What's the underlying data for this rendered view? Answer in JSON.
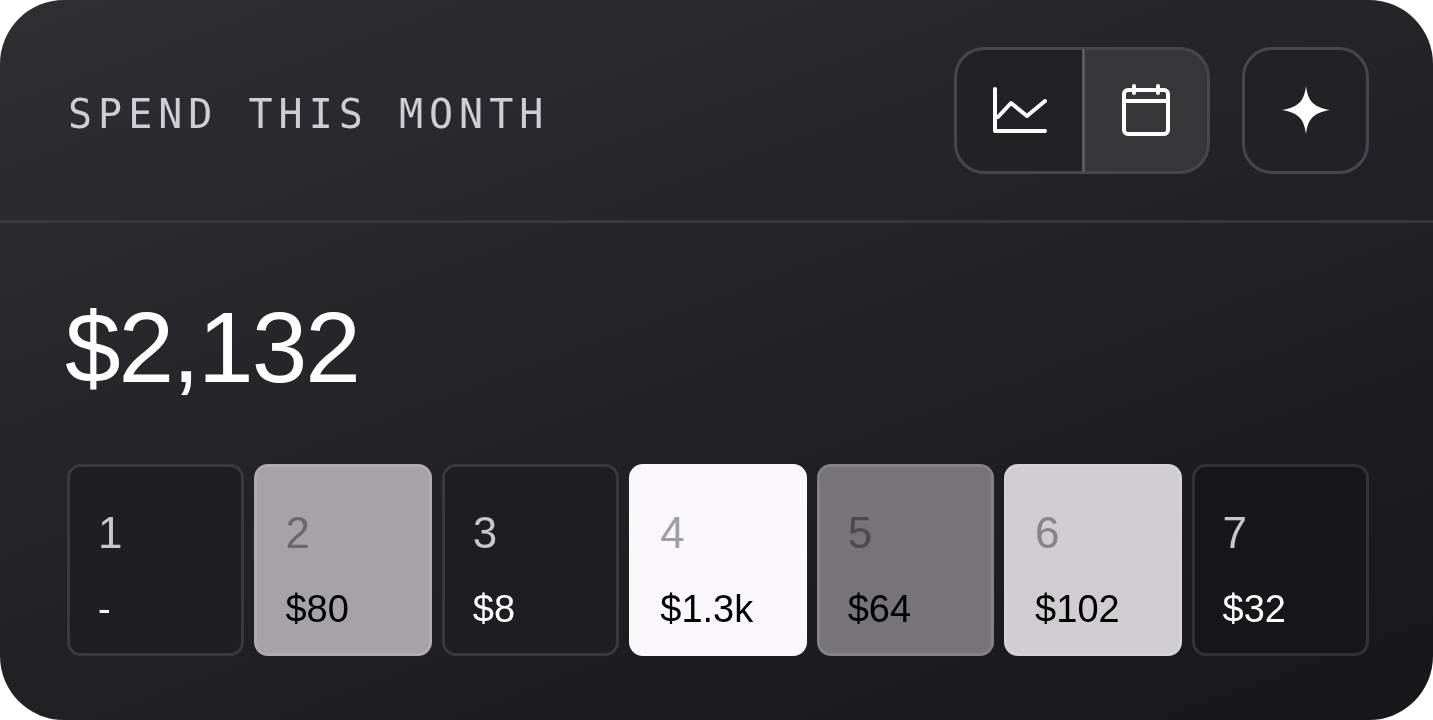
{
  "header": {
    "title": "SPEND THIS MONTH",
    "view_toggle": [
      {
        "kind": "chart",
        "selected": false
      },
      {
        "kind": "calendar",
        "selected": true
      }
    ]
  },
  "total": "$2,132",
  "days": [
    {
      "day": "1",
      "amount": "-",
      "color": "#1f1e23"
    },
    {
      "day": "2",
      "amount": "$80",
      "color": "#a5a3a7"
    },
    {
      "day": "3",
      "amount": "$8",
      "color": "#1e1d22"
    },
    {
      "day": "4",
      "amount": "$1.3k",
      "color": "#f9f7fb"
    },
    {
      "day": "5",
      "amount": "$64",
      "color": "#767479"
    },
    {
      "day": "6",
      "amount": "$102",
      "color": "#d0cdd1"
    },
    {
      "day": "7",
      "amount": "$32",
      "color": "#17161b"
    }
  ]
}
